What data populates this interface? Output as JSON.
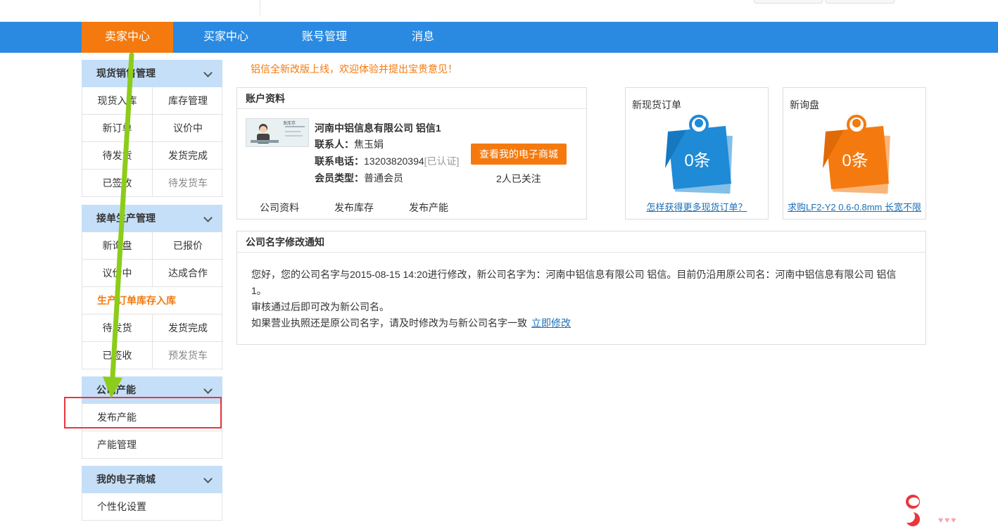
{
  "nav": {
    "items": [
      "卖家中心",
      "买家中心",
      "账号管理",
      "消息"
    ],
    "active_color": "#f47a0f",
    "bar_color": "#2a8ae1"
  },
  "sidebar": {
    "groups": [
      {
        "title": "现货销售管理",
        "cells": [
          "现货入库",
          "库存管理",
          "新订单",
          "议价中",
          "待发货",
          "发货完成",
          "已签收",
          "待发货车"
        ]
      },
      {
        "title": "接单生产管理",
        "cells": [
          "新询盘",
          "已报价",
          "议价中",
          "达成合作"
        ],
        "subtitle": "生产订单库存入库",
        "cells2": [
          "待发货",
          "发货完成",
          "已签收",
          "预发货车"
        ]
      },
      {
        "title": "公司产能",
        "items": [
          "发布产能",
          "产能管理"
        ]
      },
      {
        "title": "我的电子商城",
        "items": [
          "个性化设置"
        ]
      }
    ]
  },
  "notice": "铝信全新改版上线，欢迎体验并提出宝贵意见！",
  "account": {
    "title": "账户资料",
    "company": "河南中铝信息有限公司 铝信1",
    "contact_label": "联系人：",
    "contact": "焦玉娟",
    "phone_label": "联系电话：",
    "phone": "13203820394",
    "phone_status": "[已认证]",
    "member_label": "会员类型：",
    "member": "普通会员",
    "shop_button": "查看我的电子商城",
    "followers": "2人已关注",
    "thumb_text": "发库存",
    "tabs": [
      "公司资料",
      "发布库存",
      "发布产能"
    ]
  },
  "stats": [
    {
      "title": "新现货订单",
      "count": "0条",
      "link": "怎样获得更多现货订单？",
      "color": "#1f8ad6",
      "icon": "pin-note-icon"
    },
    {
      "title": "新询盘",
      "count": "0条",
      "link": "求购LF2-Y2 0.6-0.8mm 长宽不限",
      "color": "#f47a0f",
      "icon": "pin-note-icon"
    }
  ],
  "change_notice": {
    "title": "公司名字修改通知",
    "line1": "您好，您的公司名字与2015-08-15 14:20进行修改，新公司名字为：河南中铝信息有限公司 铝信。目前仍沿用原公司名：河南中铝信息有限公司 铝信1。",
    "line2": "审核通过后即可改为新公司名。",
    "line3": "如果营业执照还是原公司名字，请及时修改为与新公司名字一致",
    "link": "立即修改"
  }
}
